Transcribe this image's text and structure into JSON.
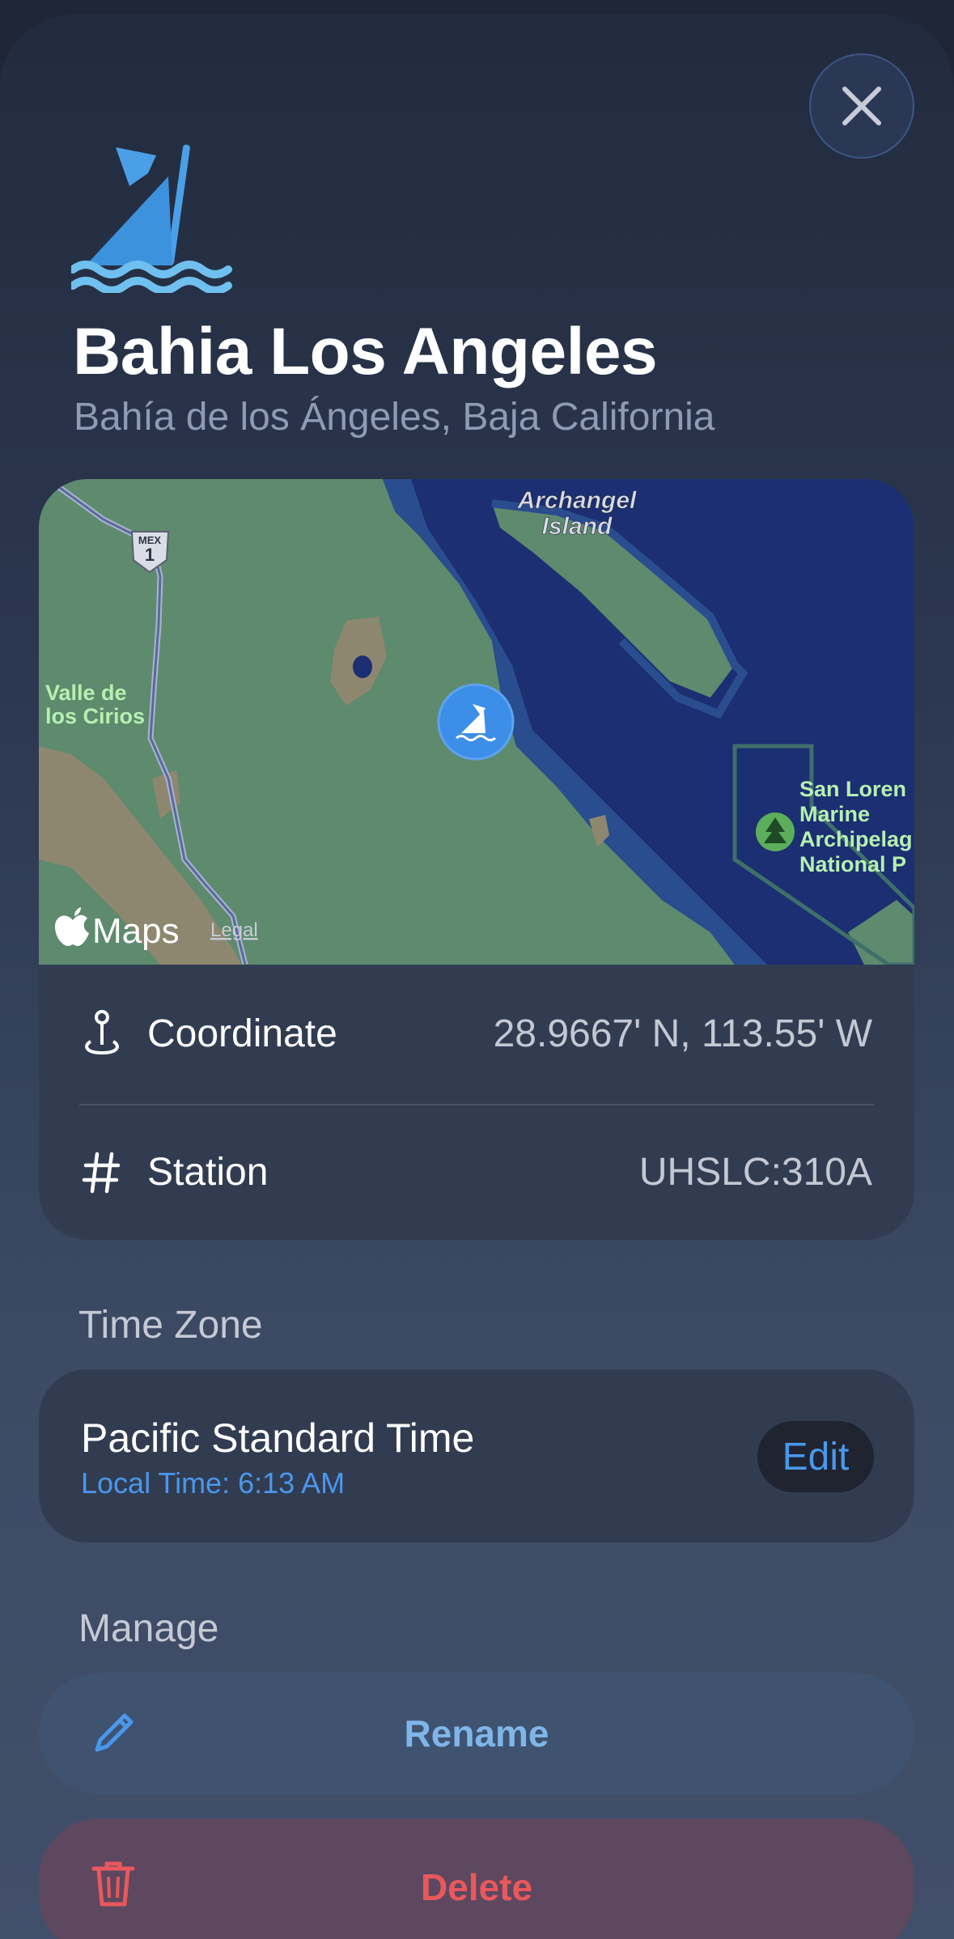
{
  "header": {
    "close_icon": "close-icon",
    "hero_icon": "sailboat-buoy-icon",
    "title": "Bahia Los Angeles",
    "subtitle": "Bahía de los Ángeles, Baja California"
  },
  "map": {
    "brand": "Maps",
    "legal": "Legal",
    "labels": {
      "island": [
        "Archangel",
        "Island"
      ],
      "valley": [
        "Valle de",
        "los Cirios"
      ],
      "park": [
        "San Loren",
        "Marine",
        "Archipelag",
        "National P"
      ],
      "highway_top": "MEX",
      "highway_number": "1"
    }
  },
  "details": {
    "coordinate": {
      "label": "Coordinate",
      "value": "28.9667' N, 113.55' W",
      "icon": "map-pin-icon"
    },
    "station": {
      "label": "Station",
      "value": "UHSLC:310A",
      "icon": "hash-icon"
    }
  },
  "time_zone": {
    "header": "Time Zone",
    "name": "Pacific Standard Time",
    "local_time": "Local Time: 6:13 AM",
    "edit_label": "Edit"
  },
  "manage": {
    "header": "Manage",
    "rename_label": "Rename",
    "delete_label": "Delete"
  },
  "colors": {
    "accent_blue": "#4a97ec",
    "rename_text": "#7fb6ea",
    "delete_text": "#e8585c",
    "land": "#5e8a6e",
    "water": "#1b2f72"
  }
}
